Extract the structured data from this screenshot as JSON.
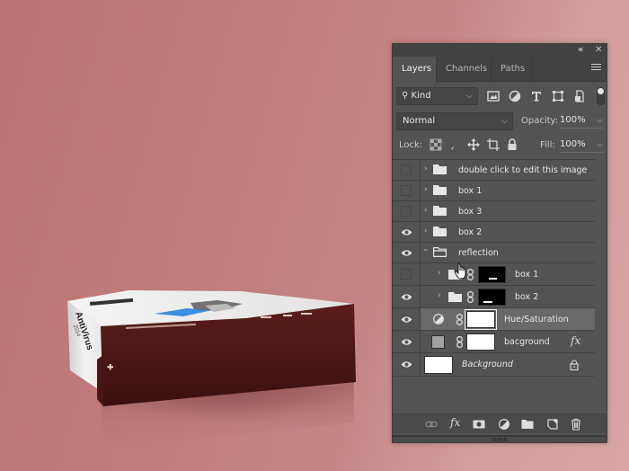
{
  "artwork": {
    "product_side_text": "AntiVirus",
    "product_year": "2014",
    "colors": {
      "background_left": "#bb7474",
      "background_right": "#d8a4a4",
      "box_front": "#4a1614",
      "box_top": "#efefef",
      "accent_blue": "#3b8ee0"
    }
  },
  "panel": {
    "titlebar": {
      "collapse_icon": "double-chevron-left",
      "close_icon": "close-x"
    },
    "tabs": [
      {
        "label": "Layers",
        "active": true
      },
      {
        "label": "Channels",
        "active": false
      },
      {
        "label": "Paths",
        "active": false
      }
    ],
    "menu_icon": "hamburger-menu",
    "filter": {
      "kind_label": "Kind",
      "icons": [
        "pixel-layer-filter",
        "adjustment-layer-filter",
        "type-layer-filter",
        "shape-layer-filter",
        "smart-object-filter"
      ],
      "toggle_on": true
    },
    "blend": {
      "mode": "Normal",
      "opacity_label": "Opacity:",
      "opacity_value": "100%"
    },
    "lock": {
      "label": "Lock:",
      "icons": [
        "lock-transparent-pixels",
        "lock-image-pixels",
        "lock-position",
        "lock-artboard",
        "lock-all"
      ],
      "fill_label": "Fill:",
      "fill_value": "100%"
    },
    "layers": [
      {
        "name": "double click to edit this image",
        "type": "group",
        "visible": false,
        "expanded": false,
        "indent": 0
      },
      {
        "name": "box 1",
        "type": "group",
        "visible": false,
        "expanded": false,
        "indent": 0
      },
      {
        "name": "box 3",
        "type": "group",
        "visible": false,
        "expanded": false,
        "indent": 0
      },
      {
        "name": "box 2",
        "type": "group",
        "visible": true,
        "expanded": false,
        "indent": 0
      },
      {
        "name": "reflection",
        "type": "group",
        "visible": true,
        "expanded": true,
        "indent": 0
      },
      {
        "name": "box 1",
        "type": "group-masked",
        "visible": false,
        "expanded": false,
        "indent": 1
      },
      {
        "name": "box 2",
        "type": "group-masked",
        "visible": true,
        "expanded": false,
        "indent": 1
      },
      {
        "name": "Hue/Saturation",
        "type": "adjustment",
        "visible": true,
        "selected": true,
        "indent": 0
      },
      {
        "name": "bacground",
        "type": "filled-masked",
        "visible": true,
        "has_fx": true,
        "fx_label": "fx",
        "indent": 0
      },
      {
        "name": "Background",
        "type": "background",
        "visible": true,
        "locked": true,
        "italic": true,
        "indent": 0
      }
    ],
    "footer_icons": [
      "link-layers",
      "add-layer-style",
      "add-mask",
      "new-adjustment-layer",
      "new-group",
      "new-layer",
      "delete-layer"
    ],
    "footer_fx_label": "fx"
  }
}
